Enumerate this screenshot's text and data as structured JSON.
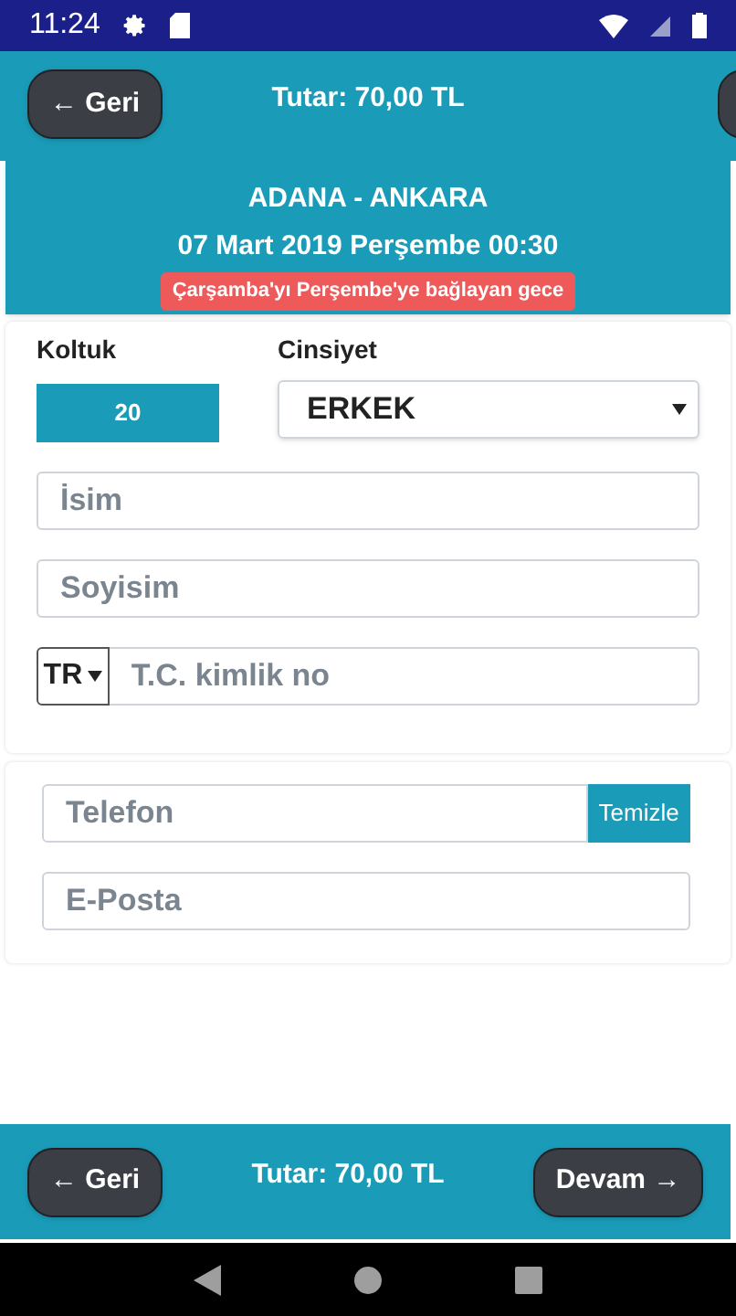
{
  "status_bar": {
    "time": "11:24"
  },
  "top_bar": {
    "back": "← Geri",
    "total": "Tutar: 70,00 TL"
  },
  "trip": {
    "route": "ADANA - ANKARA",
    "datetime": "07 Mart 2019 Perşembe 00:30",
    "note": "Çarşamba'yı Perşembe'ye bağlayan gece"
  },
  "passenger": {
    "seat_label": "Koltuk",
    "seat": "20",
    "gender_label": "Cinsiyet",
    "gender": "ERKEK",
    "name": {
      "placeholder": "İsim"
    },
    "surname": {
      "placeholder": "Soyisim"
    },
    "country": "TR",
    "id_number": {
      "placeholder": "T.C. kimlik no"
    }
  },
  "contact": {
    "phone": {
      "placeholder": "Telefon"
    },
    "clear": "Temizle",
    "email": {
      "placeholder": "E-Posta"
    }
  },
  "bottom_bar": {
    "back": "← Geri",
    "total": "Tutar: 70,00 TL",
    "next": "Devam →"
  }
}
